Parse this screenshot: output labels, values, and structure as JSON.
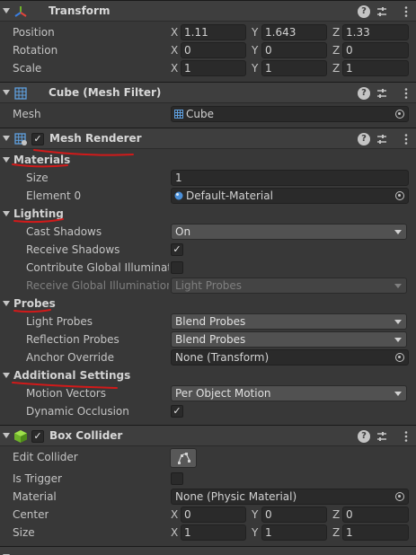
{
  "colors": {
    "annotation_red": "#d11a1a",
    "panel_bg": "#383838",
    "header_bg": "#3e3e3e"
  },
  "transform": {
    "title": "Transform",
    "icon": "transform-axes-icon",
    "position": {
      "label": "Position",
      "x": "1.11",
      "y": "1.643",
      "z": "1.33"
    },
    "rotation": {
      "label": "Rotation",
      "x": "0",
      "y": "0",
      "z": "0"
    },
    "scale": {
      "label": "Scale",
      "x": "1",
      "y": "1",
      "z": "1"
    }
  },
  "mesh_filter": {
    "title": "Cube (Mesh Filter)",
    "icon": "mesh-grid-icon",
    "mesh": {
      "label": "Mesh",
      "value": "Cube"
    }
  },
  "mesh_renderer": {
    "title": "Mesh Renderer",
    "icon": "mesh-renderer-icon",
    "enabled_mark": "✓",
    "materials_section": "Materials",
    "size": {
      "label": "Size",
      "value": "1"
    },
    "element0": {
      "label": "Element 0",
      "value": "Default-Material"
    },
    "lighting_section": "Lighting",
    "cast_shadows": {
      "label": "Cast Shadows",
      "value": "On"
    },
    "receive_shadows": {
      "label": "Receive Shadows",
      "checked_mark": "✓"
    },
    "contribute_gi": {
      "label": "Contribute Global Illuminatio"
    },
    "receive_gi": {
      "label": "Receive Global Illumination",
      "value": "Light Probes"
    },
    "probes_section": "Probes",
    "light_probes": {
      "label": "Light Probes",
      "value": "Blend Probes"
    },
    "reflection_probes": {
      "label": "Reflection Probes",
      "value": "Blend Probes"
    },
    "anchor_override": {
      "label": "Anchor Override",
      "value": "None (Transform)"
    },
    "additional_section": "Additional Settings",
    "motion_vectors": {
      "label": "Motion Vectors",
      "value": "Per Object Motion"
    },
    "dynamic_occlusion": {
      "label": "Dynamic Occlusion",
      "checked_mark": "✓"
    }
  },
  "box_collider": {
    "title": "Box Collider",
    "icon": "box-collider-icon",
    "enabled_mark": "✓",
    "edit_collider": {
      "label": "Edit Collider"
    },
    "is_trigger": {
      "label": "Is Trigger"
    },
    "material": {
      "label": "Material",
      "value": "None (Physic Material)"
    },
    "center": {
      "label": "Center",
      "x": "0",
      "y": "0",
      "z": "0"
    },
    "size": {
      "label": "Size",
      "x": "1",
      "y": "1",
      "z": "1"
    }
  },
  "axis": {
    "x": "X",
    "y": "Y",
    "z": "Z"
  },
  "header_icons": {
    "help": "?"
  }
}
